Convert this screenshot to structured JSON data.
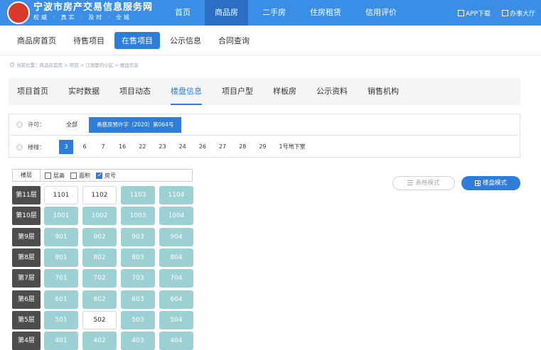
{
  "header": {
    "site_title": "宁波市房产交易信息服务网",
    "site_slogan": "权威 · 真实 · 及时 · 全城",
    "nav": [
      "首页",
      "商品房",
      "二手房",
      "住房租赁",
      "信用评价"
    ],
    "nav_active": 1,
    "app_download": "APP下载",
    "service_hall": "办事大厅"
  },
  "subnav": {
    "items": [
      "商品房首页",
      "待售项目",
      "在售项目",
      "公示信息",
      "合同查询"
    ],
    "active": 2
  },
  "breadcrumb": {
    "text": "当前位置：商品房首页 > 项目 > 江湖里的小区 > 楼盘信息"
  },
  "project_tabs": {
    "items": [
      "项目首页",
      "实时数据",
      "项目动态",
      "楼盘信息",
      "项目户型",
      "样板房",
      "公示资料",
      "销售机构"
    ],
    "active": 3
  },
  "filters": {
    "permit_label": "许可：",
    "permit_all": "全部",
    "permit_selected": "甬慈房预许字（2020）第064号",
    "building_label": "楼幢：",
    "buildings": [
      "3",
      "6",
      "7",
      "16",
      "22",
      "23",
      "24",
      "26",
      "27",
      "28",
      "29",
      "1号地下室"
    ],
    "building_active": 0
  },
  "grid": {
    "floor_header": "楼层",
    "options": [
      {
        "label": "层高",
        "checked": false
      },
      {
        "label": "面积",
        "checked": false
      },
      {
        "label": "房号",
        "checked": true
      }
    ],
    "rows": [
      {
        "floor": "第11层",
        "units": [
          {
            "no": "1101",
            "style": "white"
          },
          {
            "no": "1102",
            "style": "white"
          },
          {
            "no": "1103",
            "style": "teal"
          },
          {
            "no": "1104",
            "style": "teal"
          }
        ]
      },
      {
        "floor": "第10层",
        "units": [
          {
            "no": "1001",
            "style": "teal"
          },
          {
            "no": "1002",
            "style": "teal"
          },
          {
            "no": "1003",
            "style": "teal"
          },
          {
            "no": "1004",
            "style": "teal"
          }
        ]
      },
      {
        "floor": "第9层",
        "units": [
          {
            "no": "901",
            "style": "teal"
          },
          {
            "no": "902",
            "style": "teal"
          },
          {
            "no": "903",
            "style": "teal"
          },
          {
            "no": "904",
            "style": "teal"
          }
        ]
      },
      {
        "floor": "第8层",
        "units": [
          {
            "no": "801",
            "style": "teal"
          },
          {
            "no": "802",
            "style": "teal"
          },
          {
            "no": "803",
            "style": "teal"
          },
          {
            "no": "804",
            "style": "teal"
          }
        ]
      },
      {
        "floor": "第7层",
        "units": [
          {
            "no": "701",
            "style": "teal"
          },
          {
            "no": "702",
            "style": "teal"
          },
          {
            "no": "703",
            "style": "teal"
          },
          {
            "no": "704",
            "style": "teal"
          }
        ]
      },
      {
        "floor": "第6层",
        "units": [
          {
            "no": "601",
            "style": "teal"
          },
          {
            "no": "602",
            "style": "teal"
          },
          {
            "no": "603",
            "style": "teal"
          },
          {
            "no": "604",
            "style": "teal"
          }
        ]
      },
      {
        "floor": "第5层",
        "units": [
          {
            "no": "501",
            "style": "teal"
          },
          {
            "no": "502",
            "style": "white"
          },
          {
            "no": "503",
            "style": "teal"
          },
          {
            "no": "504",
            "style": "teal"
          }
        ]
      },
      {
        "floor": "第4层",
        "units": [
          {
            "no": "401",
            "style": "teal"
          },
          {
            "no": "402",
            "style": "teal"
          },
          {
            "no": "403",
            "style": "teal"
          },
          {
            "no": "404",
            "style": "teal"
          }
        ]
      }
    ]
  },
  "modes": {
    "table_mode": "表格模式",
    "disk_mode": "楼盘模式"
  },
  "colors": {
    "brand_blue": "#3a8ee6",
    "accent_blue": "#2f7dd8",
    "unit_available": "#9dd0d2",
    "floor_label_bg": "#4d4d4d"
  }
}
